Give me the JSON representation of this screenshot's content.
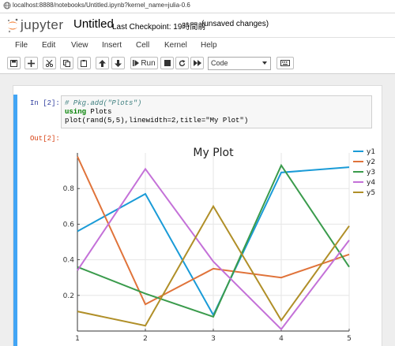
{
  "browser": {
    "url": "localhost:8888/notebooks/Untitled.ipynb?kernel_name=julia-0.6"
  },
  "header": {
    "logo_text": "jupyter",
    "notebook_title": "Untitled",
    "checkpoint": "Last Checkpoint: 19時間前",
    "unsaved": "(unsaved changes)"
  },
  "menu": [
    "File",
    "Edit",
    "View",
    "Insert",
    "Cell",
    "Kernel",
    "Help"
  ],
  "toolbar": {
    "run_label": "Run",
    "cell_type": "Code",
    "icons": [
      "save-icon",
      "plus-icon",
      "scissors-icon",
      "copy-icon",
      "paste-icon",
      "arrow-up-icon",
      "arrow-down-icon",
      "step-forward-icon",
      "stop-icon",
      "restart-icon",
      "fast-forward-icon",
      "keyboard-icon"
    ]
  },
  "cell": {
    "in_prompt": "In [2]:",
    "out_prompt": "Out[2]:",
    "code": {
      "line1": "# Pkg.add(\"Plots\")",
      "line2_keyword": "using",
      "line2_rest": " Plots",
      "line3": "plot(rand(5,5),linewidth=2,title=\"My Plot\")"
    }
  },
  "colors": {
    "accent_cell": "#42a5f5",
    "in_prompt": "#303f9f",
    "out_prompt": "#d84315"
  },
  "chart_data": {
    "type": "line",
    "title": "My Plot",
    "x": [
      1,
      2,
      3,
      4,
      5
    ],
    "xticks": [
      "1",
      "2",
      "3",
      "4",
      "5"
    ],
    "yticks": [
      "0.2",
      "0.4",
      "0.6",
      "0.8"
    ],
    "ylim": [
      0,
      1
    ],
    "grid": true,
    "legend": "top-right",
    "series": [
      {
        "name": "y1",
        "color": "#1a9bd7",
        "values": [
          0.56,
          0.77,
          0.09,
          0.89,
          0.92
        ]
      },
      {
        "name": "y2",
        "color": "#e0733a",
        "values": [
          0.98,
          0.15,
          0.35,
          0.3,
          0.43
        ]
      },
      {
        "name": "y3",
        "color": "#3a9b4c",
        "values": [
          0.36,
          0.21,
          0.08,
          0.93,
          0.36
        ]
      },
      {
        "name": "y4",
        "color": "#c471d8",
        "values": [
          0.34,
          0.91,
          0.39,
          0.01,
          0.51
        ]
      },
      {
        "name": "y5",
        "color": "#b08f28",
        "values": [
          0.11,
          0.03,
          0.7,
          0.06,
          0.59
        ]
      }
    ]
  }
}
